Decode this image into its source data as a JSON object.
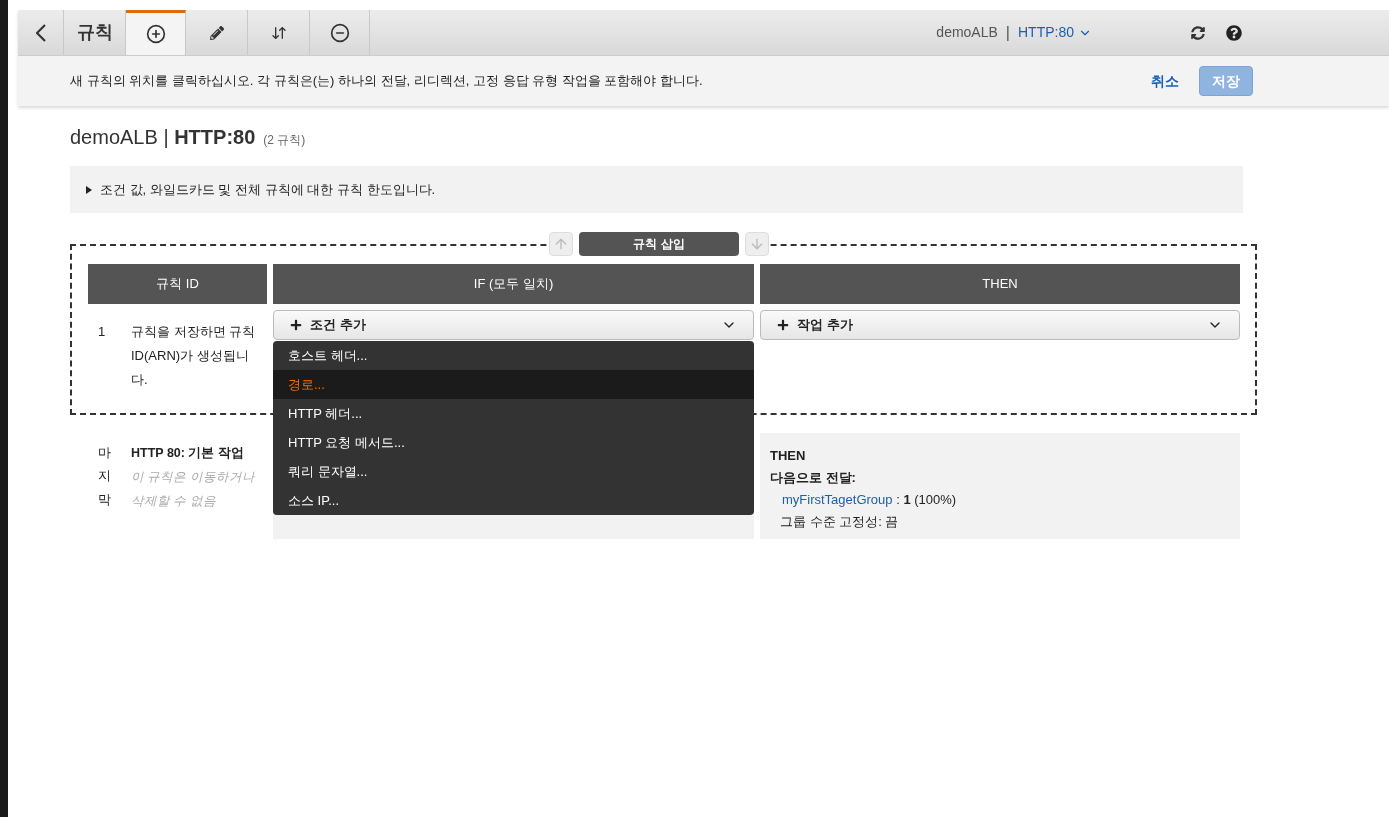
{
  "toolbar": {
    "tabs": [
      {
        "kind": "back",
        "selected": false
      },
      {
        "kind": "text",
        "label": "규칙",
        "selected": false
      },
      {
        "kind": "add",
        "selected": true
      },
      {
        "kind": "edit",
        "selected": false
      },
      {
        "kind": "reorder",
        "selected": false
      },
      {
        "kind": "delete",
        "selected": false
      }
    ],
    "load_balancer": "demoALB",
    "separator": "|",
    "listener": "HTTP:80"
  },
  "info_bar": {
    "message": "새 규칙의 위치를 클릭하십시오. 각 규칙은(는) 하나의 전달, 리디렉션, 고정 응답 유형 작업을 포함해야 합니다.",
    "cancel": "취소",
    "save": {
      "label": "저장",
      "disabled": true
    }
  },
  "heading": {
    "name": "demoALB",
    "separator": "|",
    "listener": "HTTP:80",
    "count": "(2 규칙)"
  },
  "limits_note": {
    "text": "조건 값, 와일드카드 및 전체 규칙에 대한 규칙 한도입니다.",
    "expanded": false
  },
  "insert_bar": {
    "label": "규칙 삽입"
  },
  "table": {
    "columns": [
      "규칙 ID",
      "IF (모두 일치)",
      "THEN"
    ],
    "new_rule": {
      "number": "1",
      "note": "규칙을 저장하면 규칙 ID(ARN)가 생성됩니다.",
      "condition_select": "조건 추가",
      "action_select": "작업 추가",
      "condition_menu": {
        "open": true,
        "items": [
          {
            "label": "호스트 헤더...",
            "selected": false
          },
          {
            "label": "경로...",
            "selected": true
          },
          {
            "label": "HTTP 헤더...",
            "selected": false
          },
          {
            "label": "HTTP 요청 메서드...",
            "selected": false
          },
          {
            "label": "쿼리 문자열...",
            "selected": false
          },
          {
            "label": "소스 IP...",
            "selected": false
          }
        ]
      }
    },
    "default_rule": {
      "position": "마지막",
      "title": "HTTP 80: 기본 작업",
      "note": "이 규칙은 이동하거나 삭제할 수 없음",
      "then": {
        "heading": "THEN",
        "action": "다음으로 전달:",
        "target_group": "myFirstTagetGroup",
        "separator": ":",
        "weight": "1",
        "share": "(100%)",
        "stickiness": "그룹 수준 고정성: 끔"
      }
    }
  }
}
